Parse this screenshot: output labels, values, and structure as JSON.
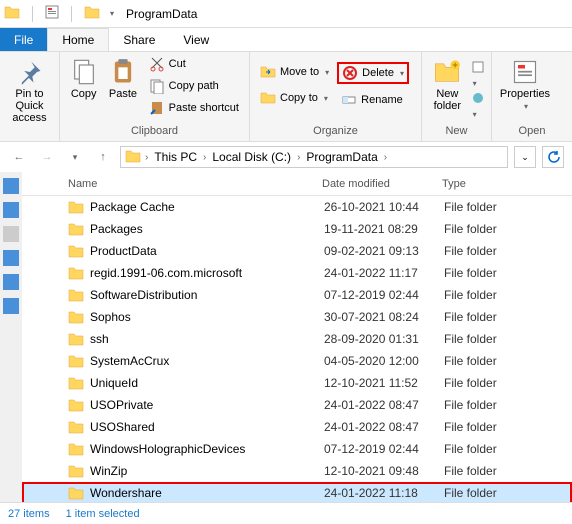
{
  "window": {
    "title": "ProgramData"
  },
  "tabs": {
    "file": "File",
    "home": "Home",
    "share": "Share",
    "view": "View"
  },
  "ribbon": {
    "pin": "Pin to Quick access",
    "copy": "Copy",
    "paste": "Paste",
    "cut": "Cut",
    "copypath": "Copy path",
    "pasteshortcut": "Paste shortcut",
    "clipboard_group": "Clipboard",
    "moveto": "Move to",
    "copyto": "Copy to",
    "delete": "Delete",
    "rename": "Rename",
    "organize_group": "Organize",
    "newfolder": "New folder",
    "new_group": "New",
    "properties": "Properties",
    "open_group": "Open"
  },
  "breadcrumb": {
    "thispc": "This PC",
    "localdisk": "Local Disk (C:)",
    "programdata": "ProgramData"
  },
  "columns": {
    "name": "Name",
    "date": "Date modified",
    "type": "Type"
  },
  "rows": [
    {
      "name": "Package Cache",
      "date": "26-10-2021 10:44",
      "type": "File folder"
    },
    {
      "name": "Packages",
      "date": "19-11-2021 08:29",
      "type": "File folder"
    },
    {
      "name": "ProductData",
      "date": "09-02-2021 09:13",
      "type": "File folder"
    },
    {
      "name": "regid.1991-06.com.microsoft",
      "date": "24-01-2022 11:17",
      "type": "File folder"
    },
    {
      "name": "SoftwareDistribution",
      "date": "07-12-2019 02:44",
      "type": "File folder"
    },
    {
      "name": "Sophos",
      "date": "30-07-2021 08:24",
      "type": "File folder"
    },
    {
      "name": "ssh",
      "date": "28-09-2020 01:31",
      "type": "File folder"
    },
    {
      "name": "SystemAcCrux",
      "date": "04-05-2020 12:00",
      "type": "File folder"
    },
    {
      "name": "UniqueId",
      "date": "12-10-2021 11:52",
      "type": "File folder"
    },
    {
      "name": "USOPrivate",
      "date": "24-01-2022 08:47",
      "type": "File folder"
    },
    {
      "name": "USOShared",
      "date": "24-01-2022 08:47",
      "type": "File folder"
    },
    {
      "name": "WindowsHolographicDevices",
      "date": "07-12-2019 02:44",
      "type": "File folder"
    },
    {
      "name": "WinZip",
      "date": "12-10-2021 09:48",
      "type": "File folder"
    },
    {
      "name": "Wondershare",
      "date": "24-01-2022 11:18",
      "type": "File folder",
      "selected": true,
      "highlight": true
    }
  ],
  "status": {
    "items": "27 items",
    "selected": "1 item selected"
  }
}
